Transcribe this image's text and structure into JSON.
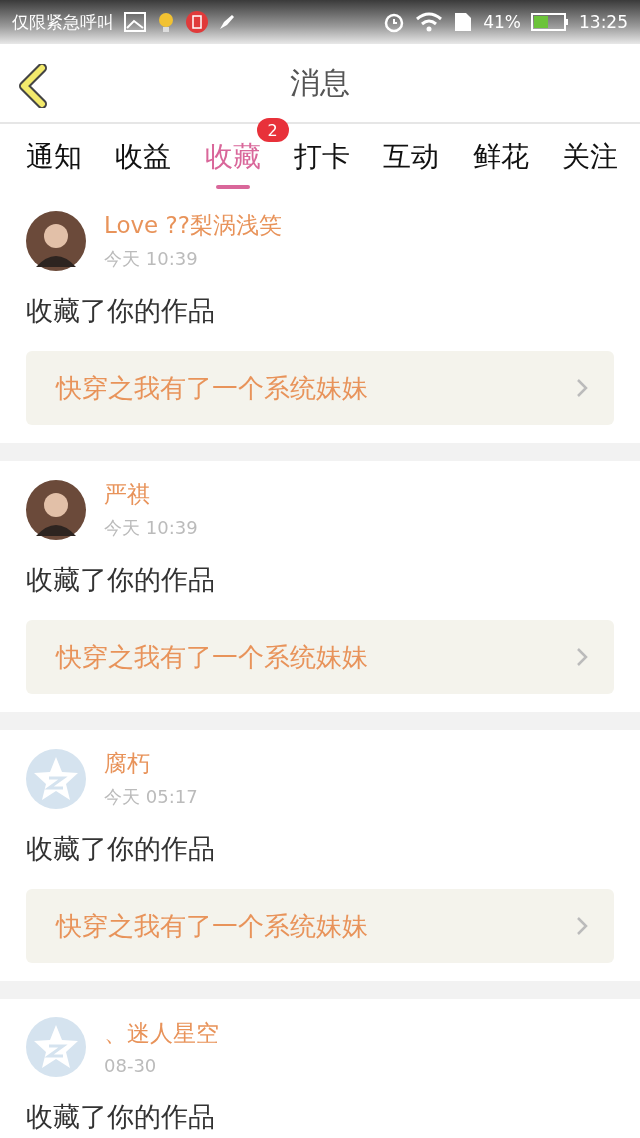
{
  "status_bar": {
    "carrier": "仅限紧急呼叫",
    "battery": "41%",
    "time": "13:25"
  },
  "header": {
    "title": "消息"
  },
  "tabs": [
    {
      "label": "通知",
      "selected": false
    },
    {
      "label": "收益",
      "selected": false
    },
    {
      "label": "收藏",
      "selected": true,
      "badge": "2"
    },
    {
      "label": "打卡",
      "selected": false
    },
    {
      "label": "互动",
      "selected": false
    },
    {
      "label": "鲜花",
      "selected": false
    },
    {
      "label": "关注",
      "selected": false
    }
  ],
  "messages": [
    {
      "avatar": {
        "kind": "photo"
      },
      "name": "Love ??梨涡浅笑",
      "time": "今天 10:39",
      "text": "收藏了你的作品",
      "work": "快穿之我有了一个系统妹妹"
    },
    {
      "avatar": {
        "kind": "photo"
      },
      "name": "严祺",
      "time": "今天 10:39",
      "text": "收藏了你的作品",
      "work": "快穿之我有了一个系统妹妹"
    },
    {
      "avatar": {
        "kind": "default"
      },
      "name": "腐朽",
      "time": "今天 05:17",
      "text": "收藏了你的作品",
      "work": "快穿之我有了一个系统妹妹"
    },
    {
      "avatar": {
        "kind": "default"
      },
      "name": "、迷人星空",
      "time": "08-30",
      "text": "收藏了你的作品"
    }
  ]
}
